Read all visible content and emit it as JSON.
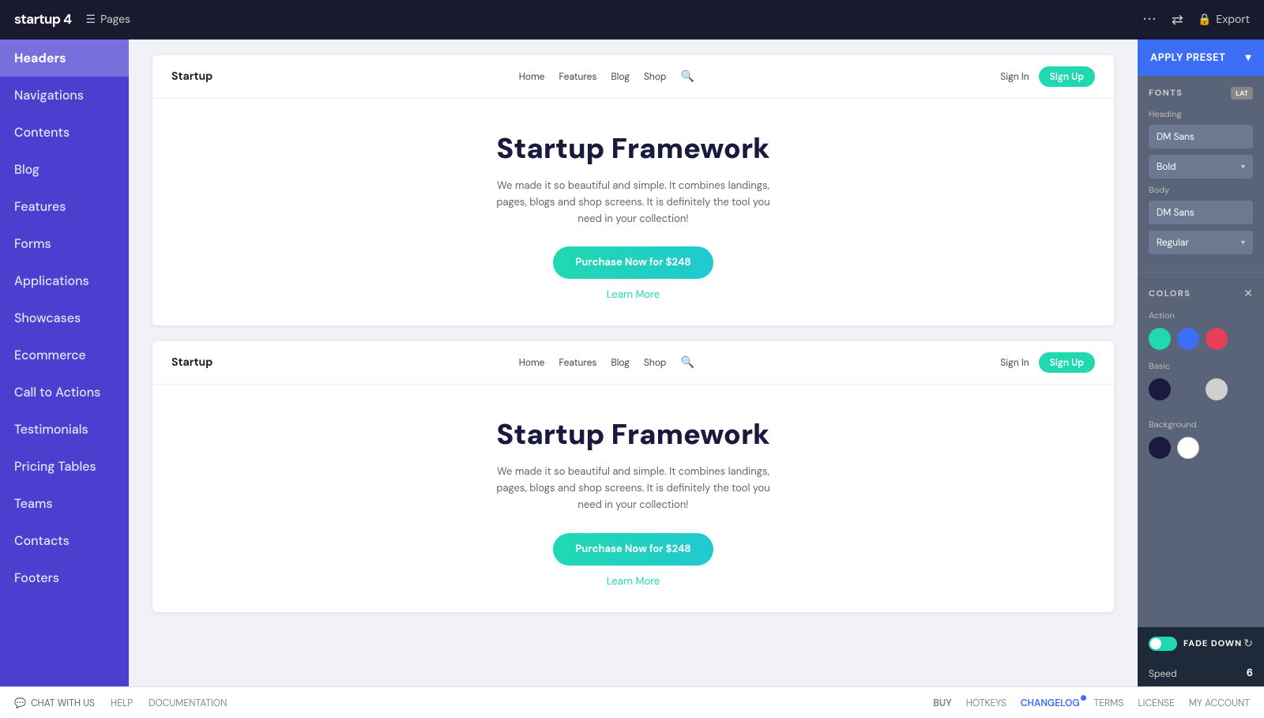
{
  "topbar": {
    "logo": "startup 4",
    "pages_label": "Pages",
    "dots": "···",
    "arrows": "⇄",
    "export_label": "Export"
  },
  "sidebar": {
    "items": [
      {
        "id": "headers",
        "label": "Headers",
        "active": true
      },
      {
        "id": "navigations",
        "label": "Navigations"
      },
      {
        "id": "contents",
        "label": "Contents"
      },
      {
        "id": "blog",
        "label": "Blog"
      },
      {
        "id": "features",
        "label": "Features"
      },
      {
        "id": "forms",
        "label": "Forms"
      },
      {
        "id": "applications",
        "label": "Applications"
      },
      {
        "id": "showcases",
        "label": "Showcases"
      },
      {
        "id": "ecommerce",
        "label": "Ecommerce"
      },
      {
        "id": "call-to-actions",
        "label": "Call to Actions"
      },
      {
        "id": "testimonials",
        "label": "Testimonials"
      },
      {
        "id": "pricing-tables",
        "label": "Pricing Tables"
      },
      {
        "id": "teams",
        "label": "Teams"
      },
      {
        "id": "contacts",
        "label": "Contacts"
      },
      {
        "id": "footers",
        "label": "Footers"
      }
    ]
  },
  "previews": [
    {
      "navbar": {
        "logo": "Startup",
        "links": [
          "Home",
          "Features",
          "Blog",
          "Shop"
        ],
        "signin": "Sign In",
        "signup": "Sign Up"
      },
      "hero": {
        "title": "Startup Framework",
        "subtitle": "We made it so beautiful and simple. It combines landings, pages, blogs and shop screens. It is definitely the tool you need in your collection!",
        "cta": "Purchase Now for $248",
        "learn_more": "Learn More"
      }
    },
    {
      "navbar": {
        "logo": "Startup",
        "links": [
          "Home",
          "Features",
          "Blog",
          "Shop"
        ],
        "signin": "Sign In",
        "signup": "Sign Up"
      },
      "hero": {
        "title": "Startup Framework",
        "subtitle": "We made it so beautiful and simple. It combines landings, pages, blogs and shop screens. It is definitely the tool you need in your collection!",
        "cta": "Purchase Now for $248",
        "learn_more": "Learn More"
      }
    }
  ],
  "right_panel": {
    "apply_preset_label": "APPLY PRESET",
    "fonts_section": {
      "title": "FONTS",
      "badge": "LAT",
      "heading_label": "Heading",
      "heading_font": "DM Sans",
      "heading_weight": "Bold",
      "body_label": "Body",
      "body_font": "DM Sans",
      "body_weight": "Regular"
    },
    "colors_section": {
      "title": "COLors",
      "action_label": "Action",
      "action_colors": [
        "#20d9b0",
        "#3b6ef5",
        "#e83e5a"
      ],
      "basic_label": "Basic",
      "basic_colors": [
        "#1a1a3e",
        "#5a6478",
        "#d0d0d0"
      ],
      "background_label": "Background",
      "background_colors": [
        "#1a1a3e",
        "#ffffff"
      ]
    },
    "fade_bar": {
      "label": "FADE DOWN",
      "speed_label": "Speed",
      "speed_value": "6"
    }
  },
  "bottombar": {
    "chat_label": "CHAT WITH US",
    "help_label": "HELP",
    "docs_label": "DOCUMENTATION",
    "buy_label": "BUY",
    "hotkeys_label": "HOTKEYS",
    "changelog_label": "CHANGELOG",
    "terms_label": "TERMS",
    "license_label": "LICENSE",
    "account_label": "MY ACCOUNT"
  }
}
